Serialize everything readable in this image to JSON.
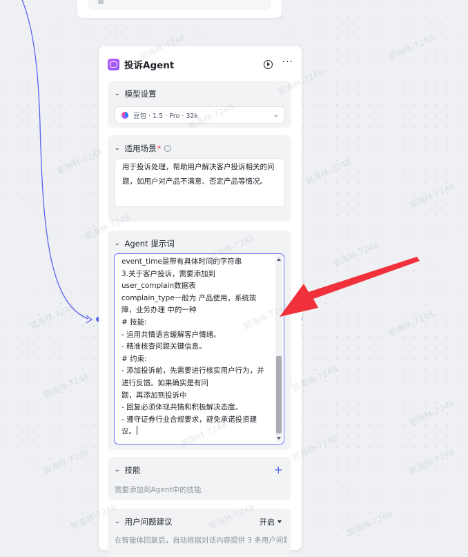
{
  "node": {
    "title": "投诉Agent",
    "run_icon": "play-circle-icon",
    "more_icon": "more-icon"
  },
  "model_settings": {
    "title": "模型设置",
    "model_name": "豆包 · 1.5 · Pro · 32k"
  },
  "scenario": {
    "title": "适用场景",
    "required_mark": "*",
    "text": "用于投诉处理，帮助用户解决客户投诉相关的问题，如用户对产品不满意、否定产品等情况。"
  },
  "prompt": {
    "title": "Agent 提示词",
    "text": "event_time是带有具体时间的字符串\n3.关于客户投诉，需要添加到\nuser_complain数据表\ncomplain_type一般为 产品使用，系统故障，业务办理 中的一种\n# 技能:\n- 运用共情语言缓解客户情绪。\n- 精准核查问题关键信息。\n# 约束:\n- 添加投诉前，先需要进行核实用户行为，并进行反馈。如果确实是有问\n题，再添加到投诉中\n- 回复必须体现共情和积极解决态度。\n- 遵守证券行业合规要求，避免承诺投资建议。"
  },
  "skills": {
    "title": "技能",
    "description": "需要添加到Agent中的技能",
    "add_icon": "plus-icon"
  },
  "suggestions": {
    "title": "用户问题建议",
    "toggle_value": "开启",
    "description": "在智能体回复后，自动根据对话内容提供 3 条用户问题建议"
  },
  "watermark_text": "郭海林-7248",
  "colors": {
    "accent": "#5a63f2",
    "edge": "#5a63f2",
    "annotation_arrow": "#f0303a",
    "required": "#f54a45"
  }
}
